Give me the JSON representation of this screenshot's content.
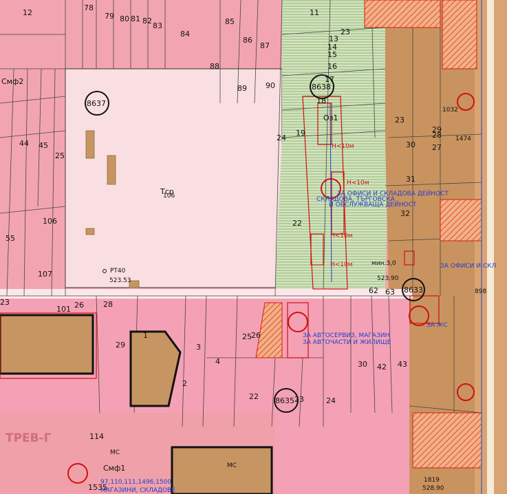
{
  "zones": {
    "left": "Смф2",
    "top_center": "Тср",
    "bottom_left": "ТРЕВ-Г",
    "bottom_center": "Смф1",
    "green_area": "Оз1"
  },
  "blocks": {
    "b8637": "8637",
    "b8638": "8638",
    "b8633": "8633",
    "b8635": "8635"
  },
  "points": {
    "pt_name": "PT40",
    "pt_value": "523.53",
    "height_right": "523.90",
    "value_small": "528.90"
  },
  "annotations": {
    "offices_warehouse": "ЗА ОФИСИ И СКЛАДОВА ДЕЙНОСТ",
    "warehouse_trade": "СКЛАДОВА, ТЪРГОВСКА",
    "service_activity": "И ОБСЛУЖВАЩА ДЕЙНОСТ",
    "auto_service": "ЗА АВТОСЕРВИЗ, МАГАЗИН",
    "auto_parts": "ЗА АВТОЧАСТИ И ЖИЛИЩЕ",
    "offices_right": "ЗА ОФИСИ И СКЛ",
    "shops_bottom": "МАГАЗИНИ, СКЛАДОВЕ",
    "numbers_bottom": "97,110,111,1496,1500",
    "h10_a": "H<10м",
    "h10_b": "H<10м",
    "h10_c": "H<10м",
    "h10_d": "H<10м",
    "min30": "мин.3,0",
    "ms": "МС",
    "ms_b": "МС",
    "zhs": "ЗА ЖС"
  },
  "parcels": {
    "p12": "12",
    "p78": "78",
    "p79": "79",
    "p80": "80",
    "p81": "81",
    "p82": "82",
    "p83": "83",
    "p84": "84",
    "p85": "85",
    "p86": "86",
    "p87": "87",
    "p88": "88",
    "p89": "89",
    "p90": "90",
    "p11": "11",
    "p13": "13",
    "p14": "14",
    "p15": "15",
    "p16": "16",
    "p17": "17",
    "p18": "18",
    "p19": "19",
    "p22": "22",
    "p23": "23",
    "p23b": "23",
    "p24": "24",
    "p27": "27",
    "p28": "28",
    "p29": "29",
    "p30": "30",
    "p31": "31",
    "p32": "32",
    "p44": "44",
    "p45": "45",
    "p25": "25",
    "p106": "106",
    "p106b": "106",
    "p55": "55",
    "p107": "107",
    "p101": "101",
    "p26": "26",
    "p28b": "28",
    "p23c": "23",
    "p25b": "25",
    "p1": "1",
    "p2": "2",
    "p3": "3",
    "p4": "4",
    "p29b": "29",
    "p22b": "22",
    "p23d": "23",
    "p24b": "24",
    "p30b": "30",
    "p42": "42",
    "p43": "43",
    "p62": "62",
    "p63": "63",
    "p114": "114",
    "p1535": "1535",
    "p1819": "1819",
    "p1474": "1474",
    "p1032": "1032",
    "p898": "898",
    "p26b": "26"
  }
}
